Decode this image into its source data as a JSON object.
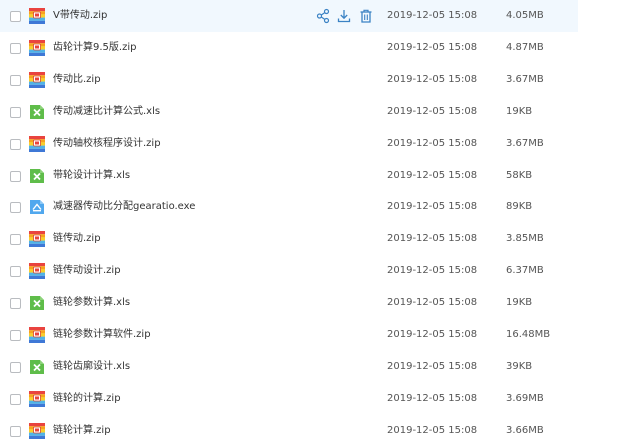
{
  "files": [
    {
      "name": "V带传动.zip",
      "date": "2019-12-05 15:08",
      "size": "4.05MB",
      "type": "zip",
      "icon": "zip-icon",
      "hover": true
    },
    {
      "name": "齿轮计算9.5版.zip",
      "date": "2019-12-05 15:08",
      "size": "4.87MB",
      "type": "zip",
      "icon": "zip-icon"
    },
    {
      "name": "传动比.zip",
      "date": "2019-12-05 15:08",
      "size": "3.67MB",
      "type": "zip",
      "icon": "zip-icon"
    },
    {
      "name": "传动减速比计算公式.xls",
      "date": "2019-12-05 15:08",
      "size": "19KB",
      "type": "xls",
      "icon": "excel-icon"
    },
    {
      "name": "传动轴校核程序设计.zip",
      "date": "2019-12-05 15:08",
      "size": "3.67MB",
      "type": "zip",
      "icon": "zip-icon"
    },
    {
      "name": "带轮设计计算.xls",
      "date": "2019-12-05 15:08",
      "size": "58KB",
      "type": "xls",
      "icon": "excel-icon"
    },
    {
      "name": "减速器传动比分配gearatio.exe",
      "date": "2019-12-05 15:08",
      "size": "89KB",
      "type": "exe",
      "icon": "exe-icon"
    },
    {
      "name": "链传动.zip",
      "date": "2019-12-05 15:08",
      "size": "3.85MB",
      "type": "zip",
      "icon": "zip-icon"
    },
    {
      "name": "链传动设计.zip",
      "date": "2019-12-05 15:08",
      "size": "6.37MB",
      "type": "zip",
      "icon": "zip-icon"
    },
    {
      "name": "链轮参数计算.xls",
      "date": "2019-12-05 15:08",
      "size": "19KB",
      "type": "xls",
      "icon": "excel-icon"
    },
    {
      "name": "链轮参数计算软件.zip",
      "date": "2019-12-05 15:08",
      "size": "16.48MB",
      "type": "zip",
      "icon": "zip-icon"
    },
    {
      "name": "链轮齿廓设计.xls",
      "date": "2019-12-05 15:08",
      "size": "39KB",
      "type": "xls",
      "icon": "excel-icon"
    },
    {
      "name": "链轮的计算.zip",
      "date": "2019-12-05 15:08",
      "size": "3.69MB",
      "type": "zip",
      "icon": "zip-icon"
    },
    {
      "name": "链轮计算.zip",
      "date": "2019-12-05 15:08",
      "size": "3.66MB",
      "type": "zip",
      "icon": "zip-icon"
    }
  ],
  "row_actions": [
    "share-icon",
    "download-icon",
    "delete-icon"
  ],
  "colors": {
    "hover_bg": "#f1f8fe",
    "action_icon": "#3b82c4",
    "excel_green": "#5fbd4a",
    "exe_blue": "#51a8ee"
  }
}
